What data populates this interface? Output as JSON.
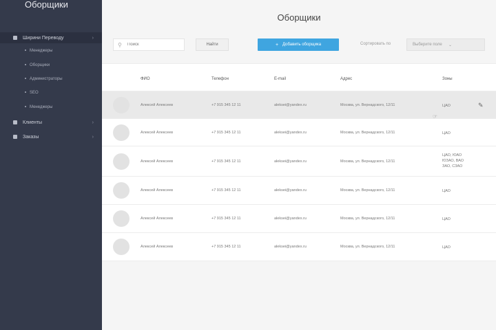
{
  "sidebar": {
    "logo": "Оборщики",
    "groups": [
      {
        "label": "Ширини Переводу",
        "chevron": "›",
        "active": true
      },
      {
        "label": "Клиенты",
        "chevron": "›",
        "active": false
      },
      {
        "label": "Заказы",
        "chevron": "›",
        "active": false
      }
    ],
    "subitems": [
      "Менеджеры",
      "Оборщики",
      "Администраторы",
      "SEO",
      "Менеджеры"
    ]
  },
  "main": {
    "title": "Оборщики",
    "search": {
      "placeholder": "Поиск",
      "button": "Найти"
    },
    "add_button": "Добавить оборщика",
    "sort": {
      "label": "Сортировать по",
      "selected": "Выберите поле"
    },
    "columns": [
      "ФИО",
      "Телефон",
      "E-mail",
      "Адрес",
      "Зоны"
    ],
    "rows": [
      {
        "name": "Алексей Алексеев",
        "phone": "+7 915 345 12 11",
        "email": "aleksei@yandex.ru",
        "address": "Москва, ул. Вернадского, 12/11",
        "zones": [
          "ЦАО"
        ]
      },
      {
        "name": "Алексей Алексеев",
        "phone": "+7 915 345 12 11",
        "email": "aleksei@yandex.ru",
        "address": "Москва, ул. Вернадского, 12/11",
        "zones": [
          "ЦАО"
        ]
      },
      {
        "name": "Алексей Алексеев",
        "phone": "+7 915 345 12 11",
        "email": "aleksei@yandex.ru",
        "address": "Москва, ул. Вернадского, 12/11",
        "zones": [
          "ЦАО, ЮАО",
          "ЮЗАО, ВАО",
          "ЗАО, СЗАО"
        ]
      },
      {
        "name": "Алексей Алексеев",
        "phone": "+7 915 345 12 11",
        "email": "aleksei@yandex.ru",
        "address": "Москва, ул. Вернадского, 12/11",
        "zones": [
          "ЦАО"
        ]
      },
      {
        "name": "Алексей Алексеев",
        "phone": "+7 915 345 12 11",
        "email": "aleksei@yandex.ru",
        "address": "Москва, ул. Вернадского, 12/11",
        "zones": [
          "ЦАО"
        ]
      },
      {
        "name": "Алексей Алексеев",
        "phone": "+7 915 345 12 11",
        "email": "aleksei@yandex.ru",
        "address": "Москва, ул. Вернадского, 12/11",
        "zones": [
          "ЦАО"
        ]
      }
    ],
    "icons": {
      "edit": "pencil-icon",
      "search": "search-icon",
      "cursor": "hand-cursor-icon"
    },
    "colors": {
      "sidebar": "#343a4b",
      "accent": "#3fa5e0"
    }
  }
}
